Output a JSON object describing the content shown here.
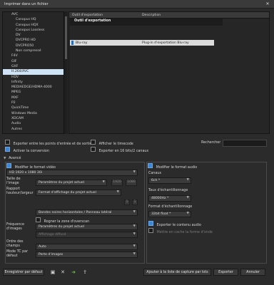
{
  "window": {
    "title": "Imprimer dans un fichier",
    "close": "✕"
  },
  "tree": [
    {
      "label": "AVC",
      "indent": 12,
      "selected": false
    },
    {
      "label": "Canopus HQ",
      "indent": 18,
      "selected": false
    },
    {
      "label": "Canopus HQX",
      "indent": 18,
      "selected": false
    },
    {
      "label": "Canopus Lossless",
      "indent": 18,
      "selected": false
    },
    {
      "label": "DV",
      "indent": 18,
      "selected": false
    },
    {
      "label": "DVCPRO HD",
      "indent": 18,
      "selected": false
    },
    {
      "label": "DVCPRO50",
      "indent": 18,
      "selected": false
    },
    {
      "label": "Non compressé",
      "indent": 18,
      "selected": false
    },
    {
      "label": "F4V",
      "indent": 12,
      "selected": false
    },
    {
      "label": "GIF",
      "indent": 12,
      "selected": false
    },
    {
      "label": "GXF",
      "indent": 12,
      "selected": false
    },
    {
      "label": "H.264/AVC",
      "indent": 12,
      "selected": true
    },
    {
      "label": "HDV",
      "indent": 12,
      "selected": false
    },
    {
      "label": "Infinity",
      "indent": 12,
      "selected": false
    },
    {
      "label": "MEDIAEDGE/HDMA-4000",
      "indent": 12,
      "selected": false
    },
    {
      "label": "MPEG",
      "indent": 12,
      "selected": false
    },
    {
      "label": "MXF",
      "indent": 12,
      "selected": false
    },
    {
      "label": "P2",
      "indent": 12,
      "selected": false
    },
    {
      "label": "QuickTime",
      "indent": 12,
      "selected": false
    },
    {
      "label": "Windows Media",
      "indent": 12,
      "selected": false
    },
    {
      "label": "XDCAM",
      "indent": 12,
      "selected": false
    },
    {
      "label": "Audio",
      "indent": 12,
      "selected": false
    },
    {
      "label": "Autres",
      "indent": 12,
      "selected": false
    }
  ],
  "exporter_panel": {
    "col_exporter": "Outil d'exportation",
    "col_description": "Description",
    "group": "Outil d'exportation",
    "row": {
      "name": "Blu-ray",
      "description": "Plug-in d'exportation Blu-ray"
    }
  },
  "options": {
    "in_out": "Exporter entre les points d'entrée et de sortie",
    "timecode": "Afficher le timecode",
    "conversion": "Activer la conversion",
    "bits16": "Exporter en 16 bits/2 canaux",
    "search_label": "Rechercher"
  },
  "advanced": {
    "toggle": "▼",
    "label": "Avancé",
    "video_format_check": "Modifier le format vidéo",
    "video_format_value": "HD 1920 x 1080 30i",
    "frame_size_label": "Taille de l'image",
    "frame_size_value": "Paramètres du projet actuel",
    "width": "1920",
    "height": "1080",
    "aspect_label": "Rapport hauteur/largeur",
    "aspect_value": "Format d'affichage du projet actuel",
    "aspect_a": "1",
    "aspect_b": "1",
    "bars_value": "Bandes noires horizontales / Panneau latéral",
    "overscan_check": "Rogner la zone d'overscan",
    "fps_label": "Fréquence d'images",
    "fps_value": "Paramètres du projet actuel",
    "fps_mode_value": "Affichage diffusé",
    "field_order_label": "Ordre des champs",
    "field_order_value": "Auto",
    "tc_mode_label": "Mode TC par défaut",
    "tc_mode_value": "Perte d'images",
    "audio_format_check": "Modifier le format audio",
    "channels_label": "Canaux",
    "channels_value": "6ch *",
    "samplerate_label": "Taux d'échantillonnage",
    "samplerate_value": "48000Hz *",
    "sampleformat_label": "Format d'échantillonnage",
    "sampleformat_value": "32bit float *",
    "export_audio_check": "Exporter le contenu audio",
    "waveform_check": "Mettre en cache la forme d'onde"
  },
  "footer": {
    "save_default": "Enregistrer par défaut",
    "add_capture": "Ajouter à la liste de capture par lots",
    "export": "Exporter",
    "cancel": "Annuler"
  }
}
